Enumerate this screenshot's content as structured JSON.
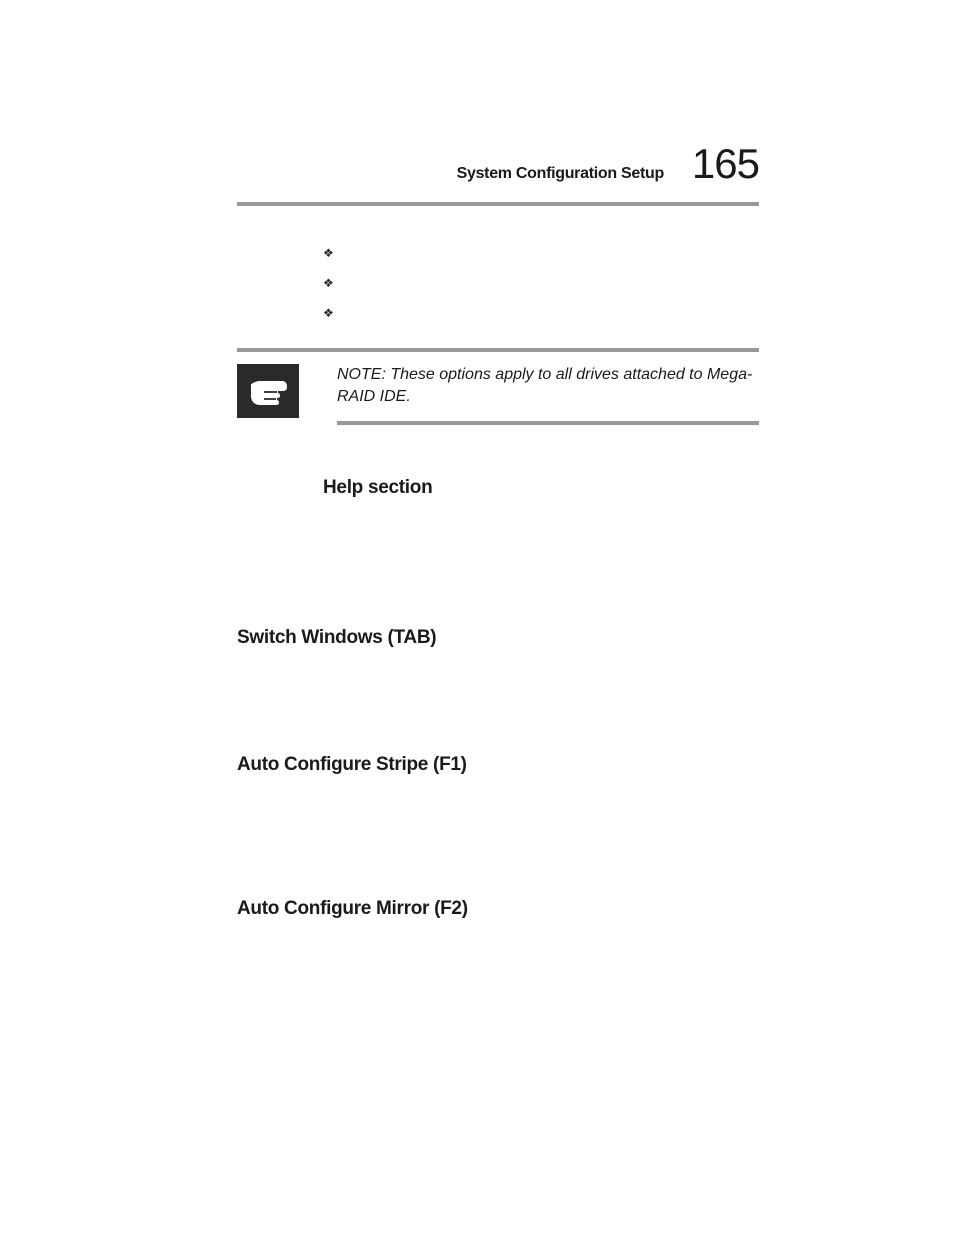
{
  "header": {
    "title": "System Configuration Setup",
    "page_number": "165"
  },
  "bullets": [
    "",
    "",
    ""
  ],
  "note": {
    "text": "NOTE: These options apply to all drives attached to Mega-RAID IDE."
  },
  "sections": {
    "help": "Help section",
    "switch": "Switch Windows (TAB)",
    "stripe": "Auto Configure Stripe (F1)",
    "mirror": "Auto Configure Mirror (F2)"
  }
}
